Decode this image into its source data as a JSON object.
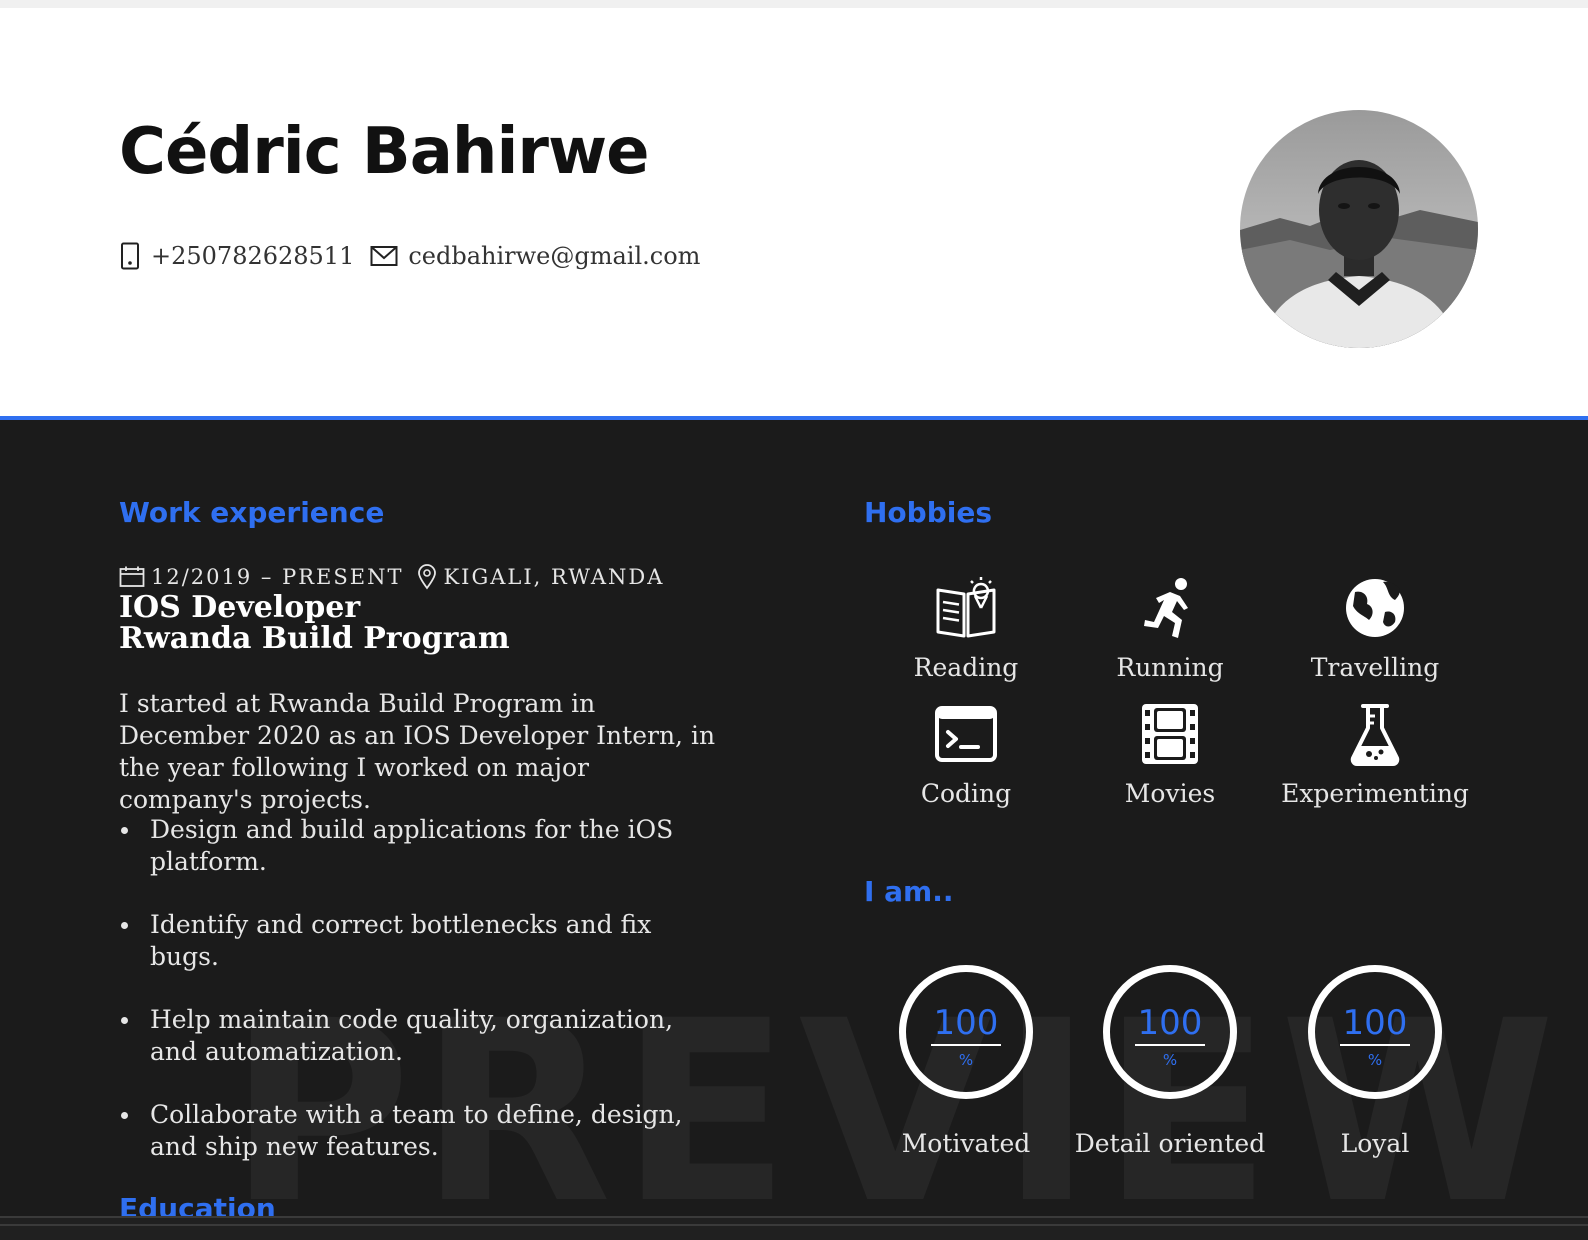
{
  "header": {
    "name": "Cédric Bahirwe",
    "phone": "+250782628511",
    "email": "cedbahirwe@gmail.com",
    "phone_icon": "phone-icon",
    "email_icon": "envelope-icon"
  },
  "watermark": "PREVIEW",
  "work": {
    "heading": "Work experience",
    "date_range": "12/2019 – PRESENT",
    "location": "KIGALI, RWANDA",
    "title": "IOS Developer",
    "company": "Rwanda Build Program",
    "summary": "I started at Rwanda Build Program in December 2020 as an IOS Developer Intern, in the year following I worked on major company's projects.",
    "bullets": [
      "Design and build applications for the iOS platform.",
      "Identify and correct bottlenecks and fix bugs.",
      "Help maintain code quality, organization, and automatization.",
      "Collaborate with a team to define, design, and ship new features."
    ]
  },
  "education": {
    "heading": "Education"
  },
  "hobbies": {
    "heading": "Hobbies",
    "items": [
      {
        "label": "Reading",
        "icon": "book-icon"
      },
      {
        "label": "Running",
        "icon": "runner-icon"
      },
      {
        "label": "Travelling",
        "icon": "globe-icon"
      },
      {
        "label": "Coding",
        "icon": "terminal-icon"
      },
      {
        "label": "Movies",
        "icon": "film-icon"
      },
      {
        "label": "Experimenting",
        "icon": "flask-icon"
      }
    ]
  },
  "traits": {
    "heading": "I am..",
    "items": [
      {
        "label": "Motivated",
        "value": "100",
        "unit": "%"
      },
      {
        "label": "Detail oriented",
        "value": "100",
        "unit": "%"
      },
      {
        "label": "Loyal",
        "value": "100",
        "unit": "%"
      }
    ]
  },
  "colors": {
    "accent": "#2f6ff0",
    "dark_background": "#1b1b1b",
    "header_background": "#ffffff",
    "text_light": "#e6e6e6"
  }
}
